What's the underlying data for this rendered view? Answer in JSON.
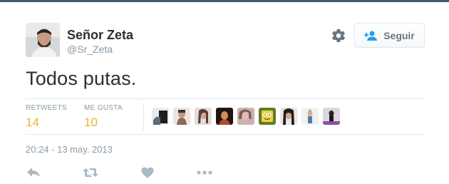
{
  "user": {
    "name": "Señor Zeta",
    "handle": "@Sr_Zeta"
  },
  "follow_button": {
    "label": "Seguir"
  },
  "tweet": {
    "text": "Todos putas.",
    "timestamp": "20:24 - 13 may. 2013"
  },
  "stats": {
    "retweets_label": "RETWEETS",
    "retweets_count": "14",
    "likes_label": "ME GUSTA",
    "likes_count": "10"
  },
  "favoriters_avatars": [
    "avatar-1",
    "avatar-2",
    "avatar-3",
    "avatar-4",
    "avatar-5",
    "avatar-6",
    "avatar-7",
    "avatar-8",
    "avatar-9"
  ],
  "icons": {
    "settings": "gear-icon",
    "follow": "add-user-icon",
    "reply": "reply-icon",
    "retweet": "retweet-icon",
    "like": "heart-icon",
    "more": "more-dots-icon"
  },
  "colors": {
    "count": "#f5b325",
    "muted": "#8899a6",
    "icon": "#aab8c2"
  }
}
